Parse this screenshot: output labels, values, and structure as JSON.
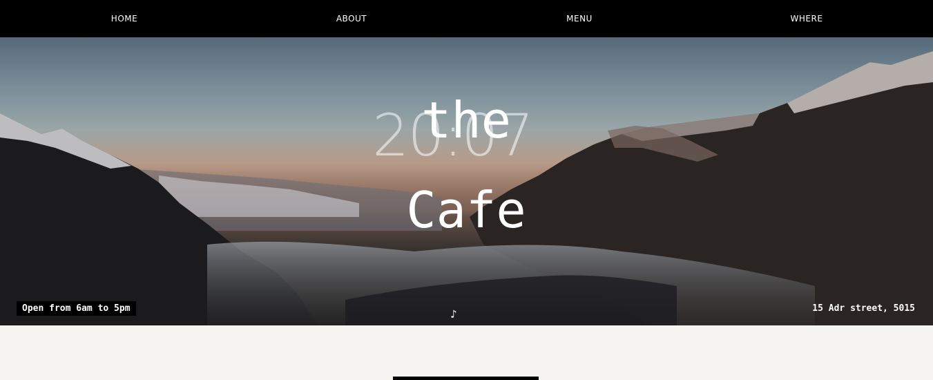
{
  "nav": {
    "items": [
      {
        "label": "HOME"
      },
      {
        "label": "ABOUT"
      },
      {
        "label": "MENU"
      },
      {
        "label": "WHERE"
      }
    ]
  },
  "hero": {
    "clock": "20:07",
    "title_line1": "the",
    "title_line2": "Cafe",
    "hours": "Open from 6am to 5pm",
    "address": "15 Adr street, 5015",
    "music_icon": "music-note-icon"
  },
  "colors": {
    "nav_bg": "#000000",
    "nav_text": "#ffffff",
    "page_bg": "#f5f4f0"
  }
}
